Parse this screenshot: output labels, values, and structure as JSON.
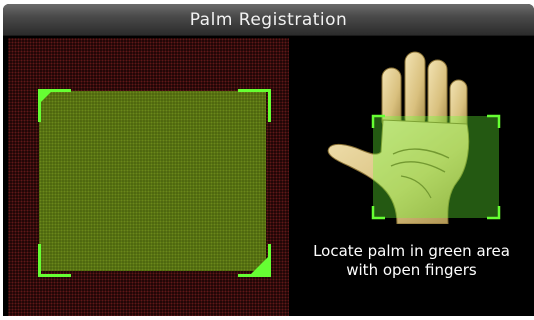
{
  "header": {
    "title": "Palm Registration"
  },
  "instruction": {
    "line1": "Locate palm in green area",
    "line2": "with open fingers"
  },
  "colors": {
    "accent_green": "#66ff33",
    "camera_background": "#1a0505",
    "title_bar": "#4a4a4a"
  },
  "icons": {
    "hand": "palm-hand-icon"
  }
}
